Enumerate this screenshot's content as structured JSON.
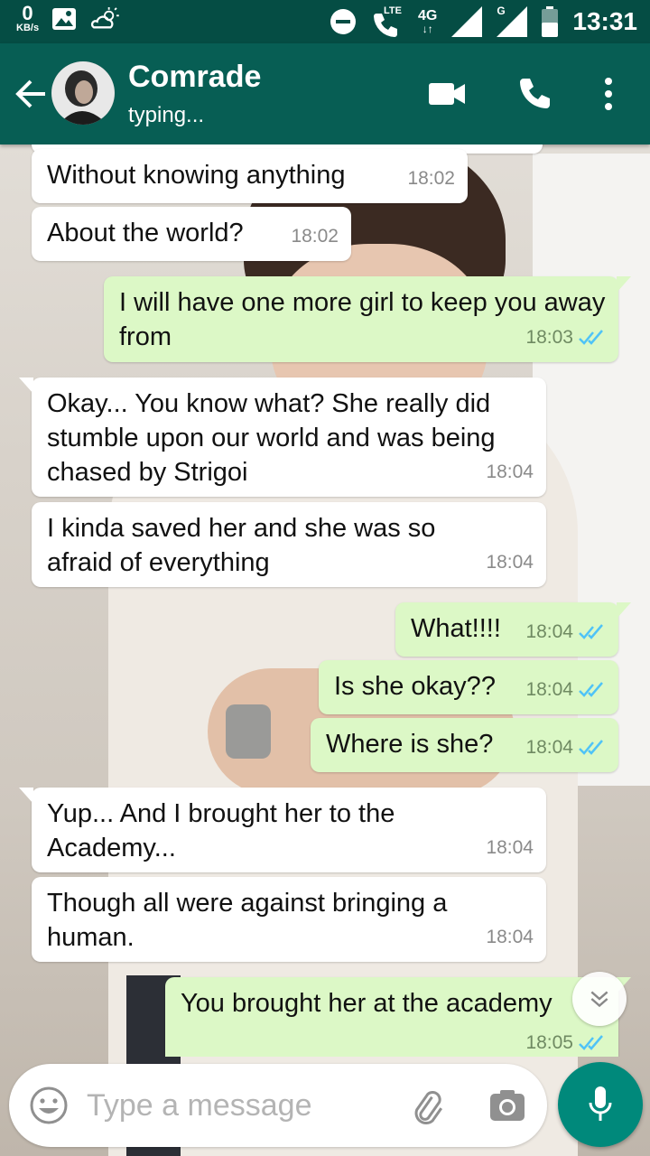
{
  "status_bar": {
    "speed_value": "0",
    "speed_unit": "KB/s",
    "lte": "LTE",
    "net_4g": "4G",
    "net_g": "G",
    "time": "13:31"
  },
  "header": {
    "contact_name": "Comrade",
    "contact_status": "typing..."
  },
  "messages": [
    {
      "dir": "in",
      "text": "Without knowing anything",
      "time": "18:02"
    },
    {
      "dir": "in",
      "text": "About the world?",
      "time": "18:02"
    },
    {
      "dir": "out",
      "text": "I will have one more girl to keep you away from",
      "time": "18:03"
    },
    {
      "dir": "in",
      "text": "Okay... You know what? She really did stumble upon our world and was being chased by Strigoi",
      "time": "18:04"
    },
    {
      "dir": "in",
      "text": "I kinda saved her and she was so afraid of everything",
      "time": "18:04"
    },
    {
      "dir": "out",
      "text": "What!!!!",
      "time": "18:04"
    },
    {
      "dir": "out",
      "text": "Is she okay??",
      "time": "18:04"
    },
    {
      "dir": "out",
      "text": "Where is she?",
      "time": "18:04"
    },
    {
      "dir": "in",
      "text": "Yup... And I brought her to the Academy...",
      "time": "18:04"
    },
    {
      "dir": "in",
      "text": "Though all were against bringing a human.",
      "time": "18:04"
    },
    {
      "dir": "out",
      "text": "You brought her at the academy",
      "time": "18:05"
    }
  ],
  "composer": {
    "placeholder": "Type a message"
  },
  "colors": {
    "app_bar": "#075e54",
    "status_bar": "#054d44",
    "outgoing_bubble": "#dcf8c6",
    "incoming_bubble": "#ffffff",
    "read_ticks": "#4fc3f7",
    "mic_button": "#00897b"
  }
}
